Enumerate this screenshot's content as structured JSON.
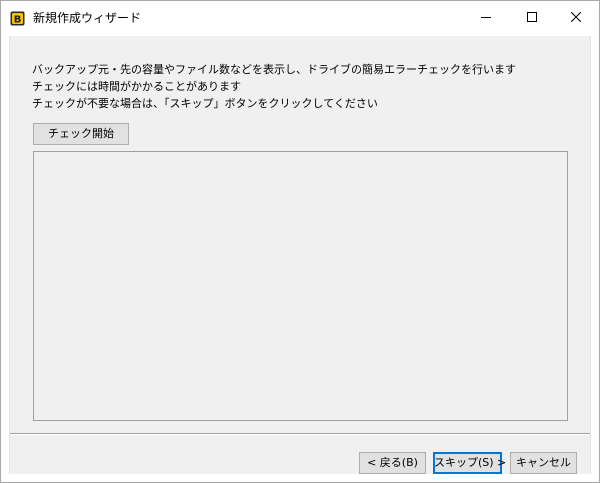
{
  "window": {
    "title": "新規作成ウィザード",
    "icon": "backup-app-icon"
  },
  "title_buttons": {
    "minimize_icon": "minimize-icon",
    "maximize_icon": "maximize-icon",
    "close_icon": "close-icon"
  },
  "content": {
    "description_lines": [
      "バックアップ元・先の容量やファイル数などを表示し、ドライブの簡易エラーチェックを行います",
      "チェックには時間がかかることがあります",
      "チェックが不要な場合は、「スキップ」ボタンをクリックしてください"
    ],
    "check_start_label": "チェック開始"
  },
  "footer": {
    "back_label": "< 戻る(B)",
    "skip_label": "スキップ(S) >",
    "cancel_label": "キャンセル"
  },
  "colors": {
    "dialog_background": "#f0f0f0",
    "default_button_border": "#0078d7",
    "icon_yellow": "#f5c400"
  }
}
